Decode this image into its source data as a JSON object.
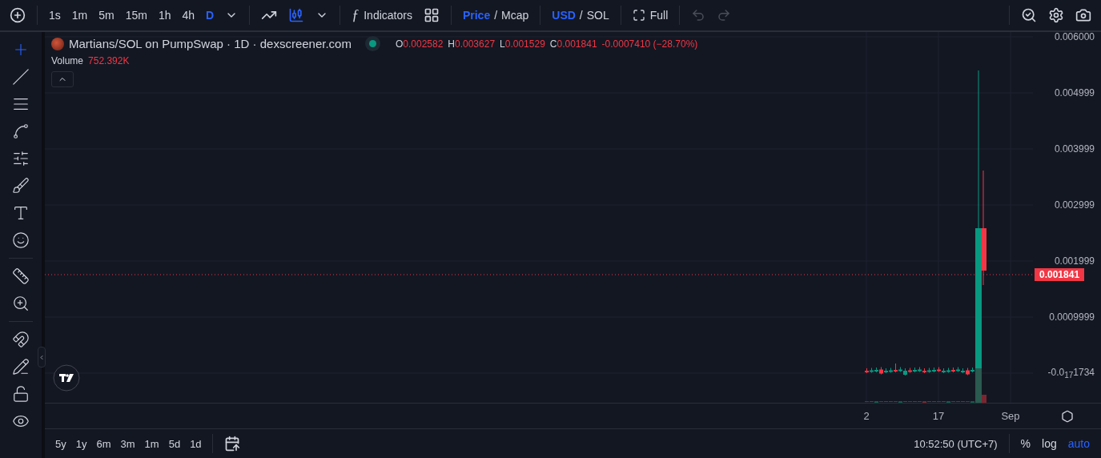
{
  "toolbar": {
    "intervals": [
      {
        "label": "1s",
        "selected": false
      },
      {
        "label": "1m",
        "selected": false
      },
      {
        "label": "5m",
        "selected": false
      },
      {
        "label": "15m",
        "selected": false
      },
      {
        "label": "1h",
        "selected": false
      },
      {
        "label": "4h",
        "selected": false
      },
      {
        "label": "D",
        "selected": true
      }
    ],
    "chart_types": [
      {
        "kind": "line",
        "selected": false
      },
      {
        "kind": "candles",
        "selected": true
      }
    ],
    "indicators_icon": "ƒ",
    "indicators_label": "Indicators",
    "price_toggle": {
      "options": [
        {
          "label": "Price",
          "selected": true
        },
        {
          "label": "Mcap",
          "selected": false
        }
      ],
      "separator": "/"
    },
    "currency_toggle": {
      "options": [
        {
          "label": "USD",
          "selected": true
        },
        {
          "label": "SOL",
          "selected": false
        }
      ],
      "separator": "/"
    },
    "fullscreen_label": "Full",
    "undo": {
      "disabled": true
    },
    "redo": {
      "disabled": true
    }
  },
  "legend": {
    "symbol": "Martians/SOL on PumpSwap · 1D · dexscreener.com",
    "ohlc": [
      {
        "label": "O",
        "value": "0.002582"
      },
      {
        "label": "H",
        "value": "0.003627"
      },
      {
        "label": "L",
        "value": "0.001529"
      },
      {
        "label": "C",
        "value": "0.001841"
      }
    ],
    "change": "-0.0007410 (−28.70%)",
    "volume_label": "Volume",
    "volume_value": "752.392K"
  },
  "price_axis": {
    "labels": [
      "0.006000",
      "0.004999",
      "0.003999",
      "0.002999",
      "0.001999",
      "0.0009999",
      "-0.0$_{17}$1734"
    ],
    "current_price": "0.001841"
  },
  "time_axis": {
    "labels": [
      "2",
      "17",
      "Sep"
    ]
  },
  "bottom_bar": {
    "ranges": [
      "5y",
      "1y",
      "6m",
      "3m",
      "1m",
      "5d",
      "1d"
    ],
    "clock": "10:52:50 (UTC+7)",
    "scale_options": [
      {
        "label": "%",
        "selected": false
      },
      {
        "label": "log",
        "selected": false
      },
      {
        "label": "auto",
        "selected": true
      }
    ]
  }
}
